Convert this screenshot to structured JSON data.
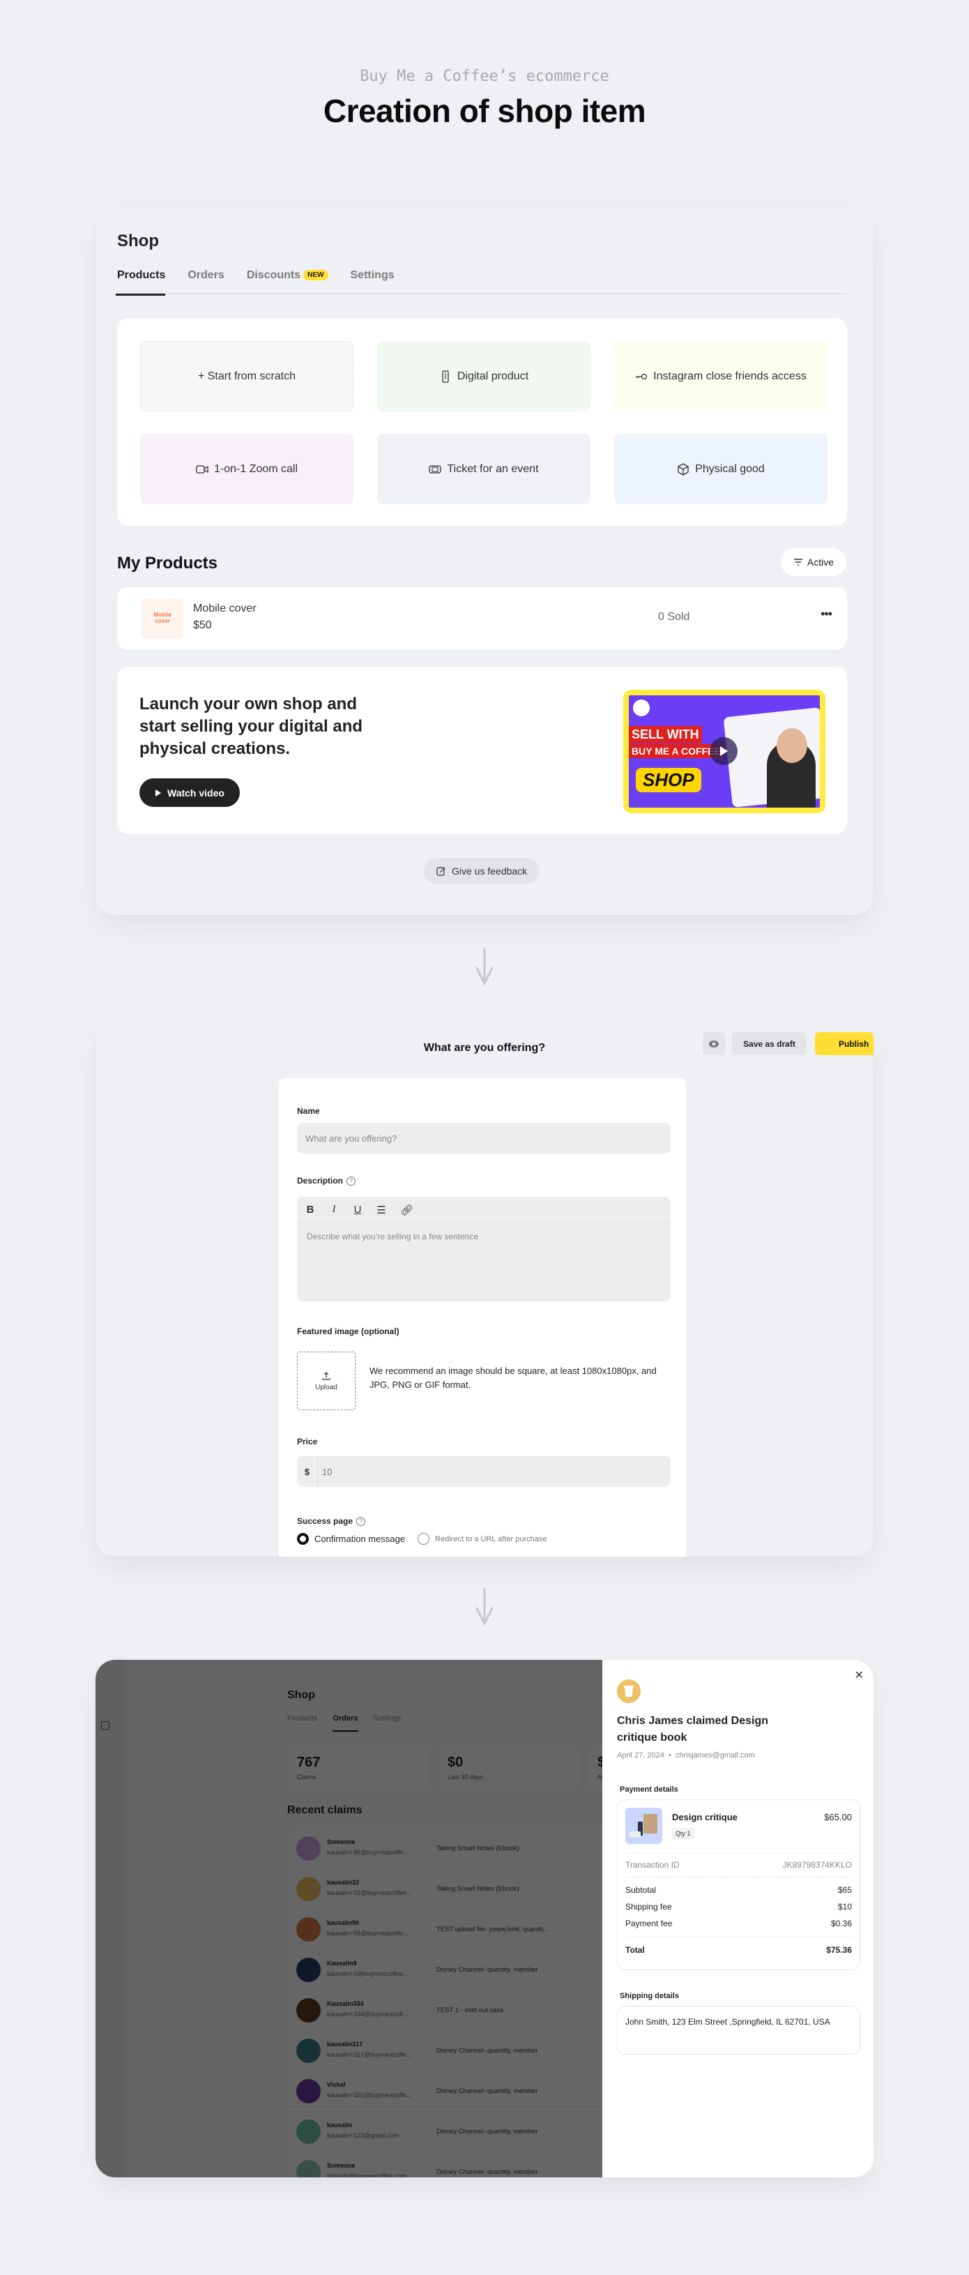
{
  "header": {
    "subtitle": "Buy Me a Coffee’s ecommerce",
    "title": "Creation of shop item"
  },
  "shop": {
    "title": "Shop",
    "tabs": [
      {
        "label": "Products",
        "active": true
      },
      {
        "label": "Orders",
        "active": false
      },
      {
        "label": "Discounts",
        "active": false,
        "badge": "NEW"
      },
      {
        "label": "Settings",
        "active": false
      }
    ],
    "product_types": [
      {
        "label": "+ Start from scratch",
        "icon": "none",
        "bg": "#f7f7f7"
      },
      {
        "label": "Digital product",
        "icon": "zip-file-icon",
        "bg": "#f0f8f0"
      },
      {
        "label": "Instagram close friends access",
        "icon": "key-icon",
        "bg": "#fdfdf0"
      },
      {
        "label": "1-on-1 Zoom call",
        "icon": "video-camera-icon",
        "bg": "#f6f0f7"
      },
      {
        "label": "Ticket for an event",
        "icon": "ticket-icon",
        "bg": "#f1f2f6"
      },
      {
        "label": "Physical good",
        "icon": "box-icon",
        "bg": "#edf4fc"
      }
    ],
    "my_products": {
      "title": "My Products",
      "filter_label": "Active",
      "items": [
        {
          "thumb_text": "Mobile cover",
          "name": "Mobile cover",
          "price": "$50",
          "sold": "0 Sold"
        }
      ]
    },
    "promo": {
      "text": "Launch your own shop and start selling your digital and physical creations.",
      "button": "Watch video",
      "video": {
        "line1": "SELL WITH",
        "line2": "BUY ME A COFFEE",
        "line3": "SHOP"
      }
    },
    "feedback_label": "Give us feedback"
  },
  "create_form": {
    "title": "What are you offering?",
    "save_draft": "Save as draft",
    "publish": "Publish",
    "name_label": "Name",
    "name_placeholder": "What are you offering?",
    "description_label": "Description",
    "description_placeholder": "Describe what you’re selling in a few sentence",
    "toolbar": [
      "B",
      "I",
      "U",
      "list",
      "link"
    ],
    "featured_label": "Featured image (optional)",
    "upload_label": "Upload",
    "upload_hint": "We recommend an image should be square, at least 1080x1080px, and JPG, PNG or GIF format.",
    "price_label": "Price",
    "currency": "$",
    "price_placeholder": "10",
    "success_label": "Success page",
    "success_options": [
      {
        "label": "Confirmation message",
        "selected": true
      },
      {
        "label": "Redirect to a URL after purchase",
        "selected": false
      }
    ]
  },
  "orders": {
    "title": "Shop",
    "tabs": [
      {
        "label": "Products",
        "active": false
      },
      {
        "label": "Orders",
        "active": true
      },
      {
        "label": "Settings",
        "active": false
      }
    ],
    "stats": [
      {
        "value": "767",
        "label": "Claims"
      },
      {
        "value": "$0",
        "label": "Last 30 days"
      },
      {
        "value": "$",
        "label": "Al"
      }
    ],
    "recent_title": "Recent claims",
    "claims": [
      {
        "name": "Someone",
        "email": "kausalin+86@buymeacoffe...",
        "product": "Taking Smart Notes (Ebook)",
        "amount": "$",
        "avatar_color": "#c9a6e0"
      },
      {
        "name": "kausalin32",
        "email": "kausalin+32@buymeacoffee...",
        "product": "Taking Smart Notes (Ebook)",
        "amount": "$",
        "avatar_color": "#f0c064"
      },
      {
        "name": "kausalin96",
        "email": "kausalin+96@buymeacoffe...",
        "product": "TEST upload file- pwyw,limit, quantit...",
        "amount": "$",
        "avatar_color": "#d97a4a"
      },
      {
        "name": "Kausalin9",
        "email": "kausalin+9@buymeacoffee....",
        "product": "Disney Channel- quantity, member",
        "amount": "$",
        "avatar_color": "#2a3d6b"
      },
      {
        "name": "Kausalin334",
        "email": "kausalin+334@buymeacoff...",
        "product": "TEST 1 - sold out case",
        "amount": "$",
        "avatar_color": "#5a3a22"
      },
      {
        "name": "kausalin317",
        "email": "kausalin+317@buymeacoffe...",
        "product": "Disney Channel- quantity, member",
        "amount": "$",
        "avatar_color": "#3a7d85"
      },
      {
        "name": "Vishal",
        "email": "kausalin+102@buymeacoffe...",
        "product": "Disney Channel- quantity, member",
        "amount": "$",
        "avatar_color": "#6a3aa0"
      },
      {
        "name": "kausalin",
        "email": "kausalin+123@gmail.com",
        "product": "Disney Channel- quantity, member",
        "amount": "$",
        "avatar_color": "#6fc2a0"
      },
      {
        "name": "Someone",
        "email": "jisjsash@buymeacoffee.com",
        "product": "Disney Channel- quantity, member",
        "amount": "$",
        "avatar_color": "#8ec9b0"
      }
    ],
    "drawer": {
      "title": "Chris James claimed Design critique book",
      "date": "April 27, 2024",
      "email": "chrisjames@gmail.com",
      "payment_title": "Payment details",
      "item_name": "Design critique",
      "item_qty": "Qty 1",
      "item_price": "$65.00",
      "transaction_label": "Transaction ID",
      "transaction_id": "JK89798374KKLO",
      "lines": [
        {
          "label": "Subtotal",
          "value": "$65"
        },
        {
          "label": "Shipping fee",
          "value": "$10"
        },
        {
          "label": "Payment fee",
          "value": "$0.36"
        }
      ],
      "total_label": "Total",
      "total_value": "$75.36",
      "shipping_title": "Shipping details",
      "shipping_address": "John Smith, 123 Elm Street ,Springfield, IL 62701, USA"
    }
  }
}
